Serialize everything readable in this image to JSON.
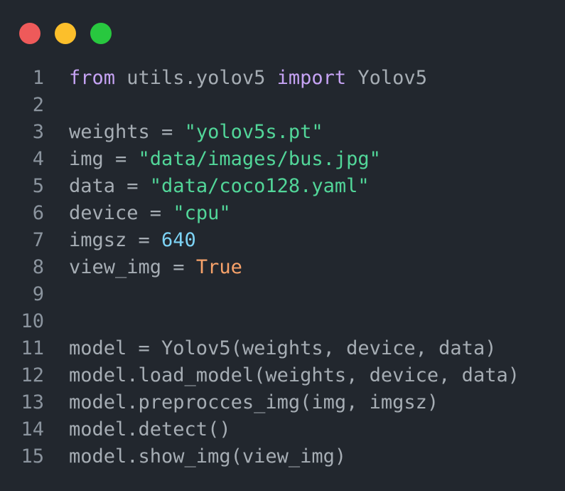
{
  "window": {
    "controls": [
      {
        "name": "close",
        "color": "#ee5a5a"
      },
      {
        "name": "minimize",
        "color": "#fcbf2b"
      },
      {
        "name": "maximize",
        "color": "#28c83f"
      }
    ]
  },
  "colors": {
    "background": "#22272e",
    "keyword": "#c6a3f4",
    "string": "#52d699",
    "number": "#7dd3f5",
    "boolean": "#f7a26a",
    "plain": "#a6adb4",
    "line_number": "#8b949e"
  },
  "editor": {
    "lines": [
      {
        "n": "1",
        "tokens": [
          {
            "t": "from",
            "c": "kw"
          },
          {
            "t": " utils.yolov5 ",
            "c": ""
          },
          {
            "t": "import",
            "c": "kw"
          },
          {
            "t": " Yolov5",
            "c": ""
          }
        ]
      },
      {
        "n": "2",
        "tokens": []
      },
      {
        "n": "3",
        "tokens": [
          {
            "t": "weights = ",
            "c": ""
          },
          {
            "t": "\"yolov5s.pt\"",
            "c": "str"
          }
        ]
      },
      {
        "n": "4",
        "tokens": [
          {
            "t": "img = ",
            "c": ""
          },
          {
            "t": "\"data/images/bus.jpg\"",
            "c": "str"
          }
        ]
      },
      {
        "n": "5",
        "tokens": [
          {
            "t": "data = ",
            "c": ""
          },
          {
            "t": "\"data/coco128.yaml\"",
            "c": "str"
          }
        ]
      },
      {
        "n": "6",
        "tokens": [
          {
            "t": "device = ",
            "c": ""
          },
          {
            "t": "\"cpu\"",
            "c": "str"
          }
        ]
      },
      {
        "n": "7",
        "tokens": [
          {
            "t": "imgsz = ",
            "c": ""
          },
          {
            "t": "640",
            "c": "num"
          }
        ]
      },
      {
        "n": "8",
        "tokens": [
          {
            "t": "view_img = ",
            "c": ""
          },
          {
            "t": "True",
            "c": "bool"
          }
        ]
      },
      {
        "n": "9",
        "tokens": []
      },
      {
        "n": "10",
        "tokens": []
      },
      {
        "n": "11",
        "tokens": [
          {
            "t": "model = Yolov5(weights, device, data)",
            "c": ""
          }
        ]
      },
      {
        "n": "12",
        "tokens": [
          {
            "t": "model.load_model(weights, device, data)",
            "c": ""
          }
        ]
      },
      {
        "n": "13",
        "tokens": [
          {
            "t": "model.preprocces_img(img, imgsz)",
            "c": ""
          }
        ]
      },
      {
        "n": "14",
        "tokens": [
          {
            "t": "model.detect()",
            "c": ""
          }
        ]
      },
      {
        "n": "15",
        "tokens": [
          {
            "t": "model.show_img(view_img)",
            "c": ""
          }
        ]
      }
    ]
  }
}
